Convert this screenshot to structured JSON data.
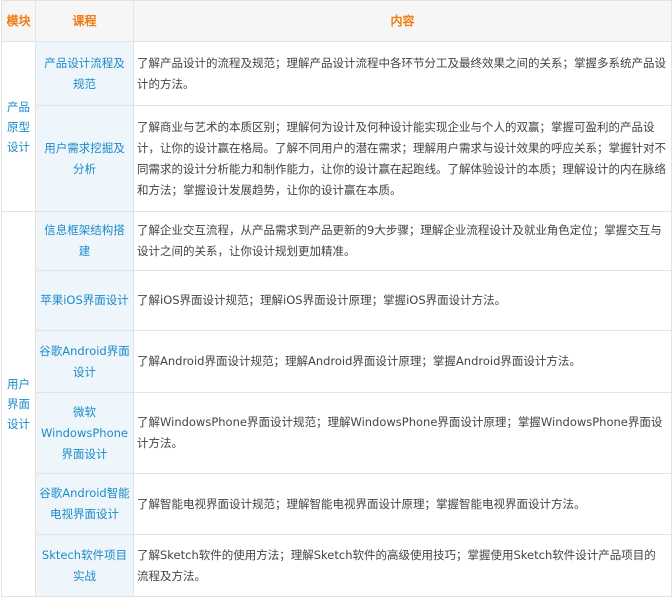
{
  "header": {
    "module": "模块",
    "course": "课程",
    "content": "内容"
  },
  "modules": [
    {
      "name": "产品原型设计",
      "rows": [
        {
          "course": "产品设计流程及规范",
          "content": "了解产品设计的流程及规范；理解产品设计流程中各环节分工及最终效果之间的关系；掌握多系统产品设计的方法。"
        },
        {
          "course": "用户需求挖掘及分析",
          "content": "了解商业与艺术的本质区别；理解何为设计及何种设计能实现企业与个人的双赢；掌握可盈利的产品设计，让你的设计赢在格局。了解不同用户的潜在需求；理解用户需求与设计效果的呼应关系；掌握针对不同需求的设计分析能力和制作能力，让你的设计赢在起跑线。了解体验设计的本质；理解设计的内在脉络和方法；掌握设计发展趋势，让你的设计赢在本质。"
        }
      ]
    },
    {
      "name": "用户界面设计",
      "rows": [
        {
          "course": "信息框架结构搭建",
          "content": "了解企业交互流程，从产品需求到产品更新的9大步骤；理解企业流程设计及就业角色定位；掌握交互与设计之间的关系，让你设计规划更加精准。"
        },
        {
          "course": "苹果iOS界面设计",
          "content": "了解iOS界面设计规范；理解iOS界面设计原理；掌握iOS界面设计方法。"
        },
        {
          "course": "谷歌Android界面设计",
          "content": "了解Android界面设计规范；理解Android界面设计原理；掌握Android界面设计方法。"
        },
        {
          "course": "微软WindowsPhone界面设计",
          "content": "了解WindowsPhone界面设计规范；理解WindowsPhone界面设计原理；掌握WindowsPhone界面设计方法。"
        },
        {
          "course": "谷歌Android智能电视界面设计",
          "content": "了解智能电视界面设计规范；理解智能电视界面设计原理；掌握智能电视界面设计方法。"
        },
        {
          "course": "Sktech软件项目实战",
          "content": "了解Sketch软件的使用方法；理解Sketch软件的高级使用技巧；掌握使用Sketch软件设计产品项目的流程及方法。"
        }
      ]
    }
  ]
}
